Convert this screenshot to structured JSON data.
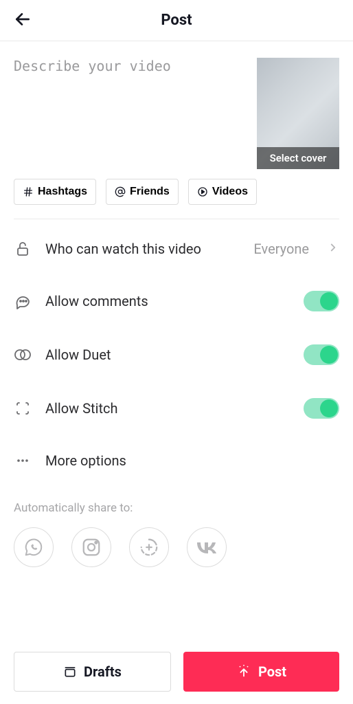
{
  "header": {
    "title": "Post"
  },
  "compose": {
    "placeholder": "Describe your video",
    "value": "",
    "cover_label": "Select cover"
  },
  "chips": {
    "hashtags": "Hashtags",
    "friends": "Friends",
    "videos": "Videos"
  },
  "settings": {
    "privacy": {
      "label": "Who can watch this video",
      "value": "Everyone"
    },
    "comments": {
      "label": "Allow comments",
      "on": true
    },
    "duet": {
      "label": "Allow Duet",
      "on": true
    },
    "stitch": {
      "label": "Allow Stitch",
      "on": true
    },
    "more": {
      "label": "More options"
    }
  },
  "share": {
    "title": "Automatically share to:",
    "targets": [
      "whatsapp",
      "instagram",
      "stories",
      "vk"
    ]
  },
  "actions": {
    "drafts": "Drafts",
    "post": "Post"
  },
  "colors": {
    "accent": "#fe2c55",
    "toggle_track": "#91e5c4",
    "toggle_knob": "#2cd58c"
  }
}
